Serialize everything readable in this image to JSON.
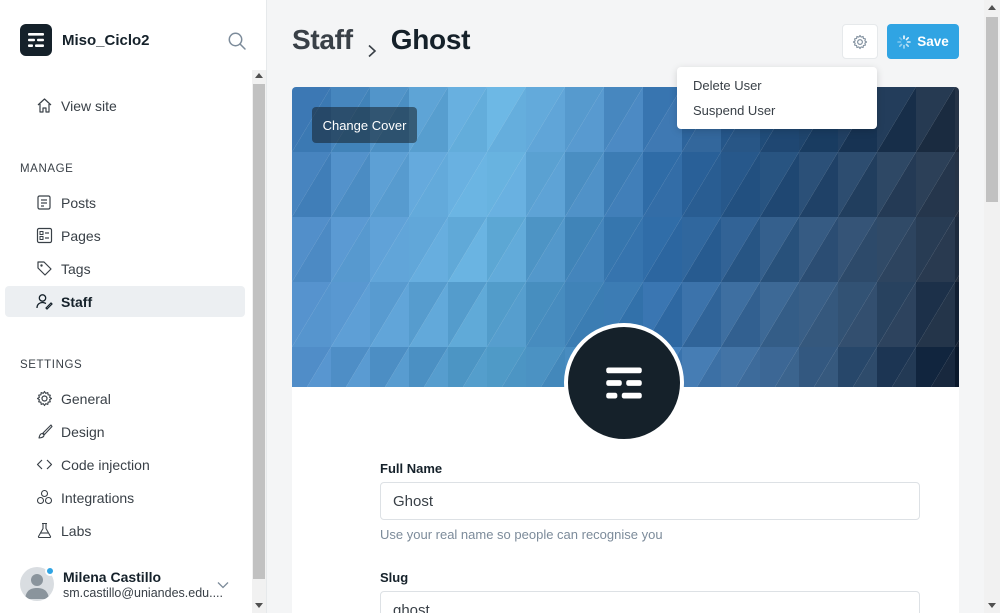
{
  "sidebar": {
    "site_name": "Miso_Ciclo2",
    "view_site": "View site",
    "manage_title": "MANAGE",
    "manage_items": [
      {
        "label": "Posts",
        "icon": "posts-icon"
      },
      {
        "label": "Pages",
        "icon": "pages-icon"
      },
      {
        "label": "Tags",
        "icon": "tag-icon"
      },
      {
        "label": "Staff",
        "icon": "staff-icon",
        "active": true
      }
    ],
    "settings_title": "SETTINGS",
    "settings_items": [
      {
        "label": "General",
        "icon": "gear-icon"
      },
      {
        "label": "Design",
        "icon": "brush-icon"
      },
      {
        "label": "Code injection",
        "icon": "code-icon"
      },
      {
        "label": "Integrations",
        "icon": "integrations-icon"
      },
      {
        "label": "Labs",
        "icon": "flask-icon"
      }
    ],
    "user": {
      "name": "Milena Castillo",
      "email": "sm.castillo@uniandes.edu...."
    }
  },
  "header": {
    "breadcrumb_parent": "Staff",
    "breadcrumb_current": "Ghost",
    "save_label": "Save"
  },
  "actions_menu": {
    "items": [
      "Delete User",
      "Suspend User"
    ]
  },
  "cover": {
    "change_cover_label": "Change Cover"
  },
  "form": {
    "full_name_label": "Full Name",
    "full_name_value": "Ghost",
    "full_name_hint": "Use your real name so people can recognise you",
    "slug_label": "Slug",
    "slug_value": "ghost"
  },
  "colors": {
    "accent": "#30a4e3",
    "dark": "#15212a"
  }
}
